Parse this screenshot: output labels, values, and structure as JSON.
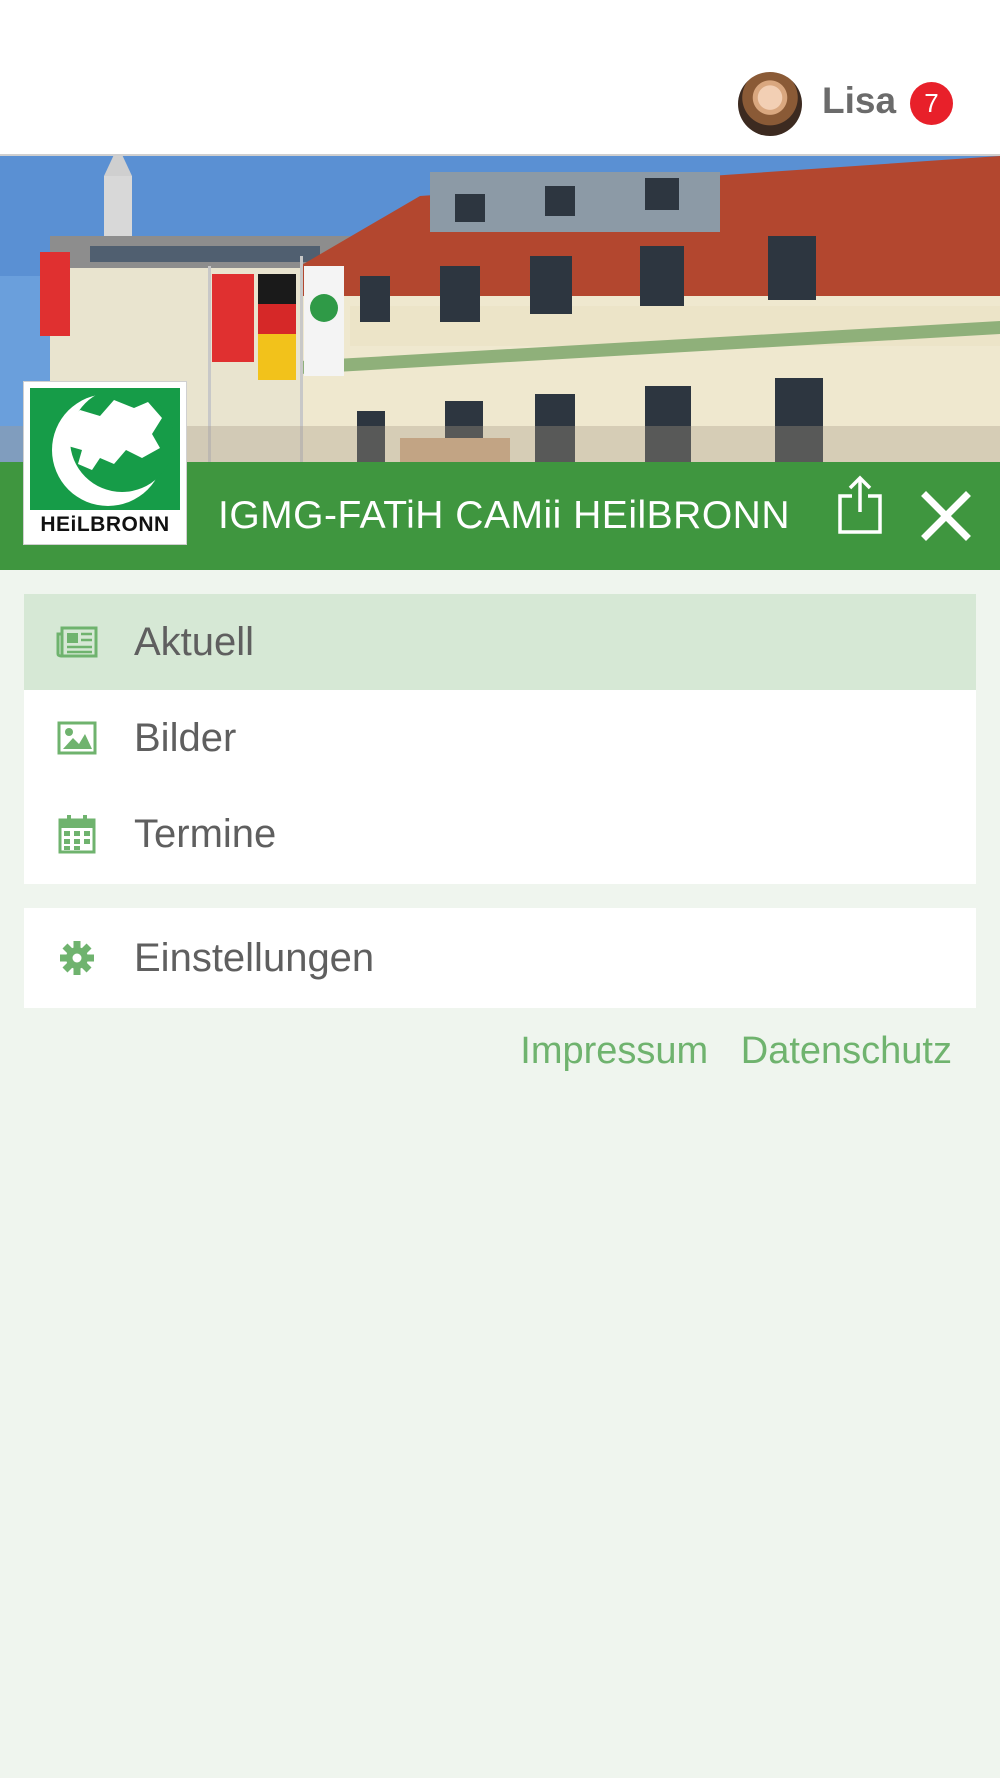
{
  "user": {
    "name": "Lisa",
    "notification_count": "7"
  },
  "brand": {
    "title": "IGMG-FATiH CAMii HEilBRONN",
    "logo_text": "HEiLBRONN"
  },
  "menu": {
    "items": [
      {
        "label": "Aktuell",
        "icon": "newspaper-icon",
        "active": true
      },
      {
        "label": "Bilder",
        "icon": "image-icon",
        "active": false
      },
      {
        "label": "Termine",
        "icon": "calendar-icon",
        "active": false
      }
    ],
    "settings": {
      "label": "Einstellungen",
      "icon": "gear-icon"
    }
  },
  "footer": {
    "impressum": "Impressum",
    "datenschutz": "Datenschutz"
  },
  "colors": {
    "brand_green": "#3f963f",
    "active_bg": "#d6e8d5",
    "page_bg": "#eff5ee",
    "link_green": "#6fb36e",
    "badge_red": "#e8202a"
  }
}
